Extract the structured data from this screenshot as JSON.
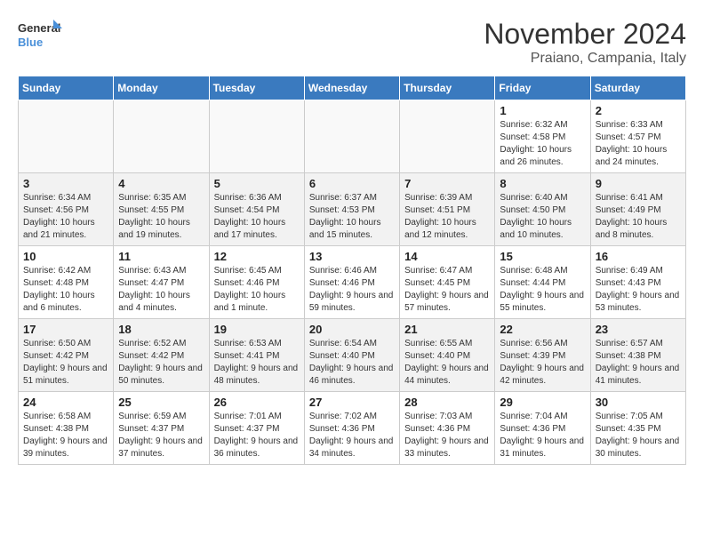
{
  "logo": {
    "line1": "General",
    "line2": "Blue"
  },
  "title": "November 2024",
  "location": "Praiano, Campania, Italy",
  "weekdays": [
    "Sunday",
    "Monday",
    "Tuesday",
    "Wednesday",
    "Thursday",
    "Friday",
    "Saturday"
  ],
  "weeks": [
    [
      {
        "day": "",
        "info": ""
      },
      {
        "day": "",
        "info": ""
      },
      {
        "day": "",
        "info": ""
      },
      {
        "day": "",
        "info": ""
      },
      {
        "day": "",
        "info": ""
      },
      {
        "day": "1",
        "info": "Sunrise: 6:32 AM\nSunset: 4:58 PM\nDaylight: 10 hours and 26 minutes."
      },
      {
        "day": "2",
        "info": "Sunrise: 6:33 AM\nSunset: 4:57 PM\nDaylight: 10 hours and 24 minutes."
      }
    ],
    [
      {
        "day": "3",
        "info": "Sunrise: 6:34 AM\nSunset: 4:56 PM\nDaylight: 10 hours and 21 minutes."
      },
      {
        "day": "4",
        "info": "Sunrise: 6:35 AM\nSunset: 4:55 PM\nDaylight: 10 hours and 19 minutes."
      },
      {
        "day": "5",
        "info": "Sunrise: 6:36 AM\nSunset: 4:54 PM\nDaylight: 10 hours and 17 minutes."
      },
      {
        "day": "6",
        "info": "Sunrise: 6:37 AM\nSunset: 4:53 PM\nDaylight: 10 hours and 15 minutes."
      },
      {
        "day": "7",
        "info": "Sunrise: 6:39 AM\nSunset: 4:51 PM\nDaylight: 10 hours and 12 minutes."
      },
      {
        "day": "8",
        "info": "Sunrise: 6:40 AM\nSunset: 4:50 PM\nDaylight: 10 hours and 10 minutes."
      },
      {
        "day": "9",
        "info": "Sunrise: 6:41 AM\nSunset: 4:49 PM\nDaylight: 10 hours and 8 minutes."
      }
    ],
    [
      {
        "day": "10",
        "info": "Sunrise: 6:42 AM\nSunset: 4:48 PM\nDaylight: 10 hours and 6 minutes."
      },
      {
        "day": "11",
        "info": "Sunrise: 6:43 AM\nSunset: 4:47 PM\nDaylight: 10 hours and 4 minutes."
      },
      {
        "day": "12",
        "info": "Sunrise: 6:45 AM\nSunset: 4:46 PM\nDaylight: 10 hours and 1 minute."
      },
      {
        "day": "13",
        "info": "Sunrise: 6:46 AM\nSunset: 4:46 PM\nDaylight: 9 hours and 59 minutes."
      },
      {
        "day": "14",
        "info": "Sunrise: 6:47 AM\nSunset: 4:45 PM\nDaylight: 9 hours and 57 minutes."
      },
      {
        "day": "15",
        "info": "Sunrise: 6:48 AM\nSunset: 4:44 PM\nDaylight: 9 hours and 55 minutes."
      },
      {
        "day": "16",
        "info": "Sunrise: 6:49 AM\nSunset: 4:43 PM\nDaylight: 9 hours and 53 minutes."
      }
    ],
    [
      {
        "day": "17",
        "info": "Sunrise: 6:50 AM\nSunset: 4:42 PM\nDaylight: 9 hours and 51 minutes."
      },
      {
        "day": "18",
        "info": "Sunrise: 6:52 AM\nSunset: 4:42 PM\nDaylight: 9 hours and 50 minutes."
      },
      {
        "day": "19",
        "info": "Sunrise: 6:53 AM\nSunset: 4:41 PM\nDaylight: 9 hours and 48 minutes."
      },
      {
        "day": "20",
        "info": "Sunrise: 6:54 AM\nSunset: 4:40 PM\nDaylight: 9 hours and 46 minutes."
      },
      {
        "day": "21",
        "info": "Sunrise: 6:55 AM\nSunset: 4:40 PM\nDaylight: 9 hours and 44 minutes."
      },
      {
        "day": "22",
        "info": "Sunrise: 6:56 AM\nSunset: 4:39 PM\nDaylight: 9 hours and 42 minutes."
      },
      {
        "day": "23",
        "info": "Sunrise: 6:57 AM\nSunset: 4:38 PM\nDaylight: 9 hours and 41 minutes."
      }
    ],
    [
      {
        "day": "24",
        "info": "Sunrise: 6:58 AM\nSunset: 4:38 PM\nDaylight: 9 hours and 39 minutes."
      },
      {
        "day": "25",
        "info": "Sunrise: 6:59 AM\nSunset: 4:37 PM\nDaylight: 9 hours and 37 minutes."
      },
      {
        "day": "26",
        "info": "Sunrise: 7:01 AM\nSunset: 4:37 PM\nDaylight: 9 hours and 36 minutes."
      },
      {
        "day": "27",
        "info": "Sunrise: 7:02 AM\nSunset: 4:36 PM\nDaylight: 9 hours and 34 minutes."
      },
      {
        "day": "28",
        "info": "Sunrise: 7:03 AM\nSunset: 4:36 PM\nDaylight: 9 hours and 33 minutes."
      },
      {
        "day": "29",
        "info": "Sunrise: 7:04 AM\nSunset: 4:36 PM\nDaylight: 9 hours and 31 minutes."
      },
      {
        "day": "30",
        "info": "Sunrise: 7:05 AM\nSunset: 4:35 PM\nDaylight: 9 hours and 30 minutes."
      }
    ]
  ]
}
